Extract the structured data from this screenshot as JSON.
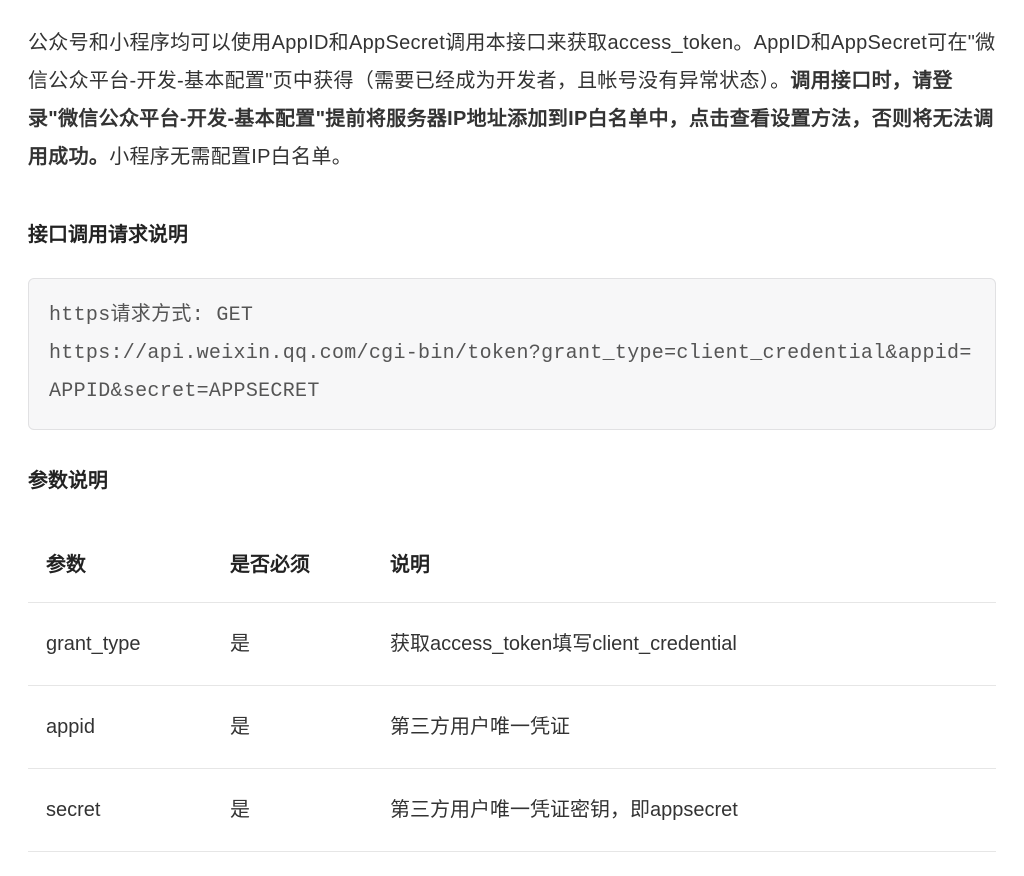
{
  "intro": {
    "text_before_bold": "公众号和小程序均可以使用AppID和AppSecret调用本接口来获取access_token。AppID和AppSecret可在\"微信公众平台-开发-基本配置\"页中获得（需要已经成为开发者，且帐号没有异常状态）。",
    "bold_text": "调用接口时，请登录\"微信公众平台-开发-基本配置\"提前将服务器IP地址添加到IP白名单中，点击查看设置方法，否则将无法调用成功。",
    "text_after_bold": "小程序无需配置IP白名单。"
  },
  "section1_heading": "接口调用请求说明",
  "code_block": "https请求方式: GET\nhttps://api.weixin.qq.com/cgi-bin/token?grant_type=client_credential&appid=APPID&secret=APPSECRET",
  "section2_heading": "参数说明",
  "table": {
    "headers": {
      "col1": "参数",
      "col2": "是否必须",
      "col3": "说明"
    },
    "rows": [
      {
        "param": "grant_type",
        "required": "是",
        "desc": "获取access_token填写client_credential"
      },
      {
        "param": "appid",
        "required": "是",
        "desc": "第三方用户唯一凭证"
      },
      {
        "param": "secret",
        "required": "是",
        "desc": "第三方用户唯一凭证密钥，即appsecret"
      }
    ]
  }
}
